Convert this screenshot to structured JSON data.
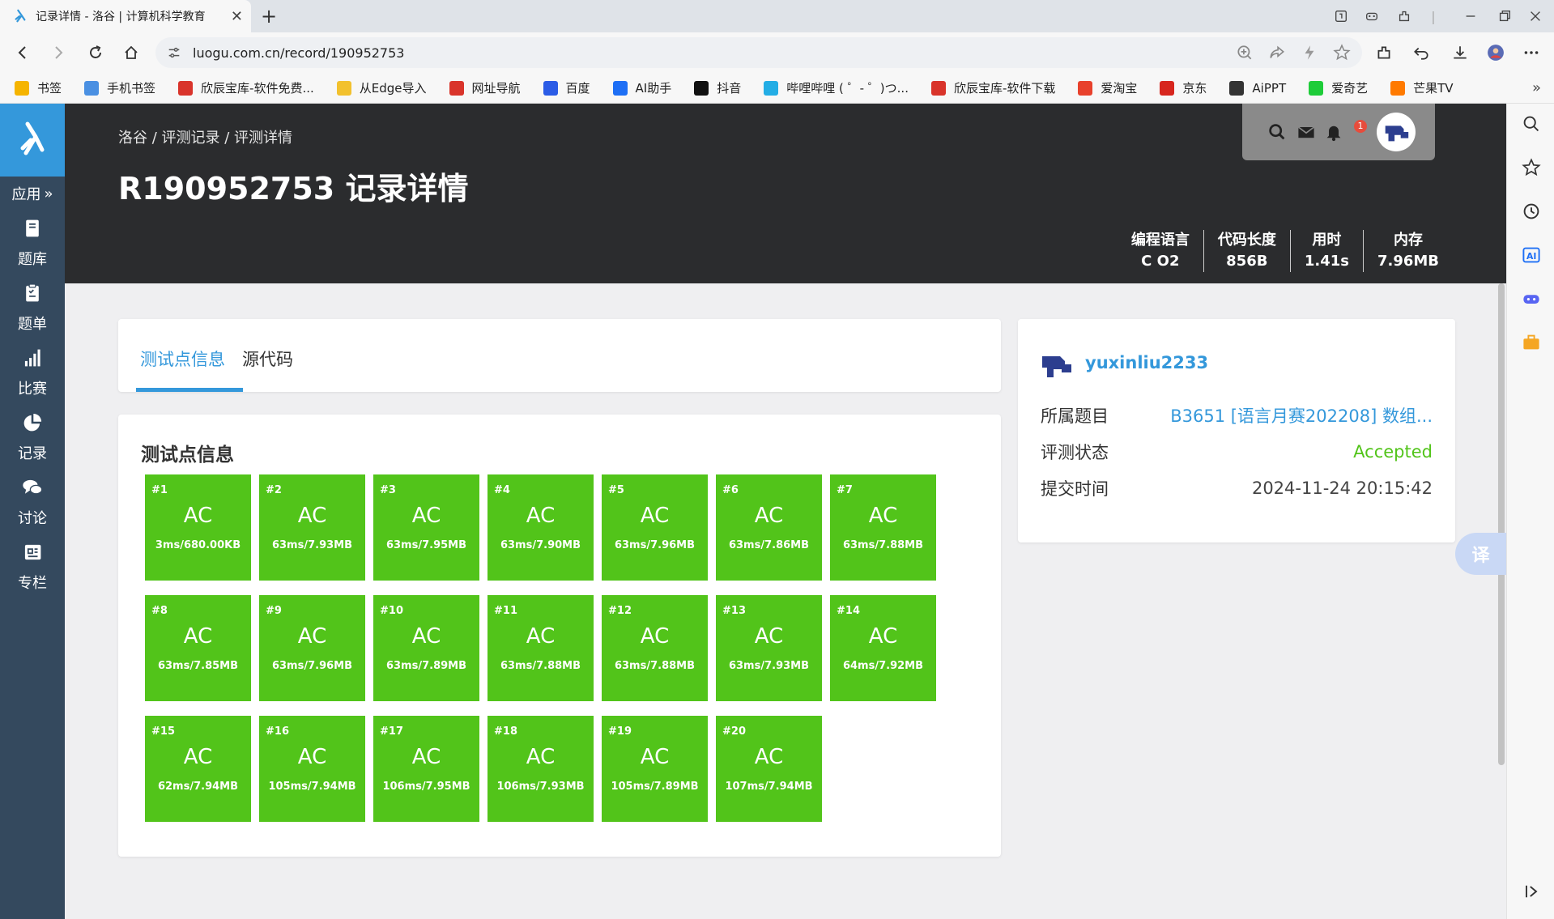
{
  "browser": {
    "tab_title": "记录详情 - 洛谷 | 计算机科学教育",
    "url": "luogu.com.cn/record/190952753",
    "bookmarks": [
      {
        "label": "书签",
        "color": "#f5b400"
      },
      {
        "label": "手机书签",
        "color": "#4a90e2"
      },
      {
        "label": "欣辰宝库-软件免费...",
        "color": "#d9342b"
      },
      {
        "label": "从Edge导入",
        "color": "#f2c12e"
      },
      {
        "label": "网址导航",
        "color": "#d9342b"
      },
      {
        "label": "百度",
        "color": "#2b5ce6"
      },
      {
        "label": "AI助手",
        "color": "#1e6ff5"
      },
      {
        "label": "抖音",
        "color": "#111111"
      },
      {
        "label": "哔哩哔哩 ( ゜- ゜)つ...",
        "color": "#23ade5"
      },
      {
        "label": "欣辰宝库-软件下载",
        "color": "#d9342b"
      },
      {
        "label": "爱淘宝",
        "color": "#e8412c"
      },
      {
        "label": "京东",
        "color": "#d7261e"
      },
      {
        "label": "AiPPT",
        "color": "#333333"
      },
      {
        "label": "爱奇艺",
        "color": "#1ecc39"
      },
      {
        "label": "芒果TV",
        "color": "#ff7a00"
      }
    ]
  },
  "nav": {
    "app_label": "应用",
    "items": [
      {
        "label": "题库",
        "icon": "book-icon"
      },
      {
        "label": "题单",
        "icon": "clipboard-icon"
      },
      {
        "label": "比赛",
        "icon": "bar-chart-icon"
      },
      {
        "label": "记录",
        "icon": "pie-chart-icon"
      },
      {
        "label": "讨论",
        "icon": "chat-icon"
      },
      {
        "label": "专栏",
        "icon": "newspaper-icon"
      }
    ]
  },
  "header": {
    "breadcrumb": "洛谷 / 评测记录 / 评测详情",
    "title": "R190952753 记录详情",
    "notification_count": "1",
    "stats": [
      {
        "key": "编程语言",
        "value": "C O2"
      },
      {
        "key": "代码长度",
        "value": "856B"
      },
      {
        "key": "用时",
        "value": "1.41s"
      },
      {
        "key": "内存",
        "value": "7.96MB"
      }
    ]
  },
  "tabs": {
    "active": "测试点信息",
    "other": "源代码"
  },
  "tests": {
    "heading": "测试点信息",
    "accent": "#52c41a",
    "cases": [
      {
        "id": "#1",
        "status": "AC",
        "meta": "3ms/680.00KB"
      },
      {
        "id": "#2",
        "status": "AC",
        "meta": "63ms/7.93MB"
      },
      {
        "id": "#3",
        "status": "AC",
        "meta": "63ms/7.95MB"
      },
      {
        "id": "#4",
        "status": "AC",
        "meta": "63ms/7.90MB"
      },
      {
        "id": "#5",
        "status": "AC",
        "meta": "63ms/7.96MB"
      },
      {
        "id": "#6",
        "status": "AC",
        "meta": "63ms/7.86MB"
      },
      {
        "id": "#7",
        "status": "AC",
        "meta": "63ms/7.88MB"
      },
      {
        "id": "#8",
        "status": "AC",
        "meta": "63ms/7.85MB"
      },
      {
        "id": "#9",
        "status": "AC",
        "meta": "63ms/7.96MB"
      },
      {
        "id": "#10",
        "status": "AC",
        "meta": "63ms/7.89MB"
      },
      {
        "id": "#11",
        "status": "AC",
        "meta": "63ms/7.88MB"
      },
      {
        "id": "#12",
        "status": "AC",
        "meta": "63ms/7.88MB"
      },
      {
        "id": "#13",
        "status": "AC",
        "meta": "63ms/7.93MB"
      },
      {
        "id": "#14",
        "status": "AC",
        "meta": "64ms/7.92MB"
      },
      {
        "id": "#15",
        "status": "AC",
        "meta": "62ms/7.94MB"
      },
      {
        "id": "#16",
        "status": "AC",
        "meta": "105ms/7.94MB"
      },
      {
        "id": "#17",
        "status": "AC",
        "meta": "106ms/7.95MB"
      },
      {
        "id": "#18",
        "status": "AC",
        "meta": "106ms/7.93MB"
      },
      {
        "id": "#19",
        "status": "AC",
        "meta": "105ms/7.89MB"
      },
      {
        "id": "#20",
        "status": "AC",
        "meta": "107ms/7.94MB"
      }
    ]
  },
  "info": {
    "username": "yuxinliu2233",
    "rows": [
      {
        "label": "所属题目",
        "value": "B3651 [语言月赛202208] 数组...",
        "color": "#3498db"
      },
      {
        "label": "评测状态",
        "value": "Accepted",
        "color": "#52c41a"
      },
      {
        "label": "提交时间",
        "value": "2024-11-24 20:15:42",
        "color": "#444444"
      }
    ]
  },
  "translate_label": "译"
}
